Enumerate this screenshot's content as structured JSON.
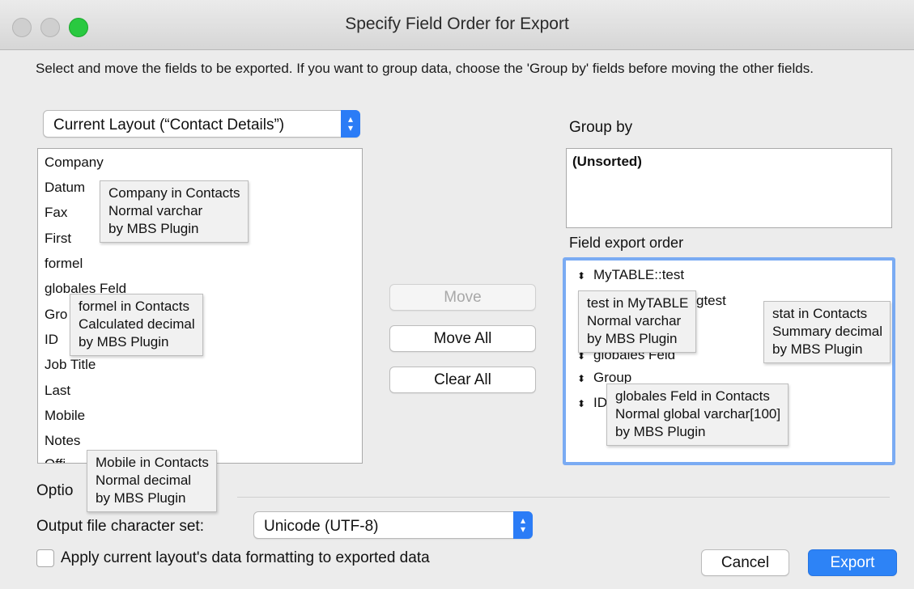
{
  "window": {
    "title": "Specify Field Order for Export"
  },
  "instructions": "Select and move the fields to be exported.  If you want to group data, choose the 'Group by' fields before moving the other fields.",
  "source_popup": {
    "selected": "Current Layout (“Contact Details”)"
  },
  "source_fields": [
    "Company",
    "Datum",
    "Fax",
    "First",
    "formel",
    "globales Feld",
    "Gro",
    "ID",
    "Job Title",
    "Last",
    "Mobile",
    "Notes",
    "Offi"
  ],
  "buttons": {
    "move": "Move",
    "move_all": "Move All",
    "clear_all": "Clear All",
    "cancel": "Cancel",
    "export": "Export"
  },
  "group_by": {
    "label": "Group by",
    "items": [
      "(Unsorted)"
    ]
  },
  "field_export_order": {
    "label": "Field export order",
    "items": [
      "MyTABLE::test",
      "gtest",
      "globales Feld",
      "Group",
      "ID"
    ]
  },
  "options": {
    "label": "Optio",
    "charset_label": "Output file character set:",
    "charset_value": "Unicode (UTF-8)",
    "apply_formatting_label": "Apply current layout's data formatting to exported data",
    "apply_formatting_checked": false
  },
  "tooltips": {
    "company": [
      "Company in Contacts",
      "Normal varchar",
      "by MBS Plugin"
    ],
    "formel": [
      "formel in Contacts",
      "Calculated decimal",
      "by MBS Plugin"
    ],
    "mobile": [
      "Mobile in Contacts",
      "Normal decimal",
      "by MBS Plugin"
    ],
    "test": [
      "test in MyTABLE",
      "Normal varchar",
      "by MBS Plugin"
    ],
    "stat": [
      "stat in Contacts",
      "Summary decimal",
      "by MBS Plugin"
    ],
    "globales": [
      "globales Feld in Contacts",
      "Normal global varchar[100]",
      "by MBS Plugin"
    ]
  },
  "icons": {
    "order_grip": "⬍",
    "stepper_up": "▴",
    "stepper_down": "▾"
  },
  "colors": {
    "accent": "#2d83f6",
    "zoom_button": "#29c940"
  }
}
